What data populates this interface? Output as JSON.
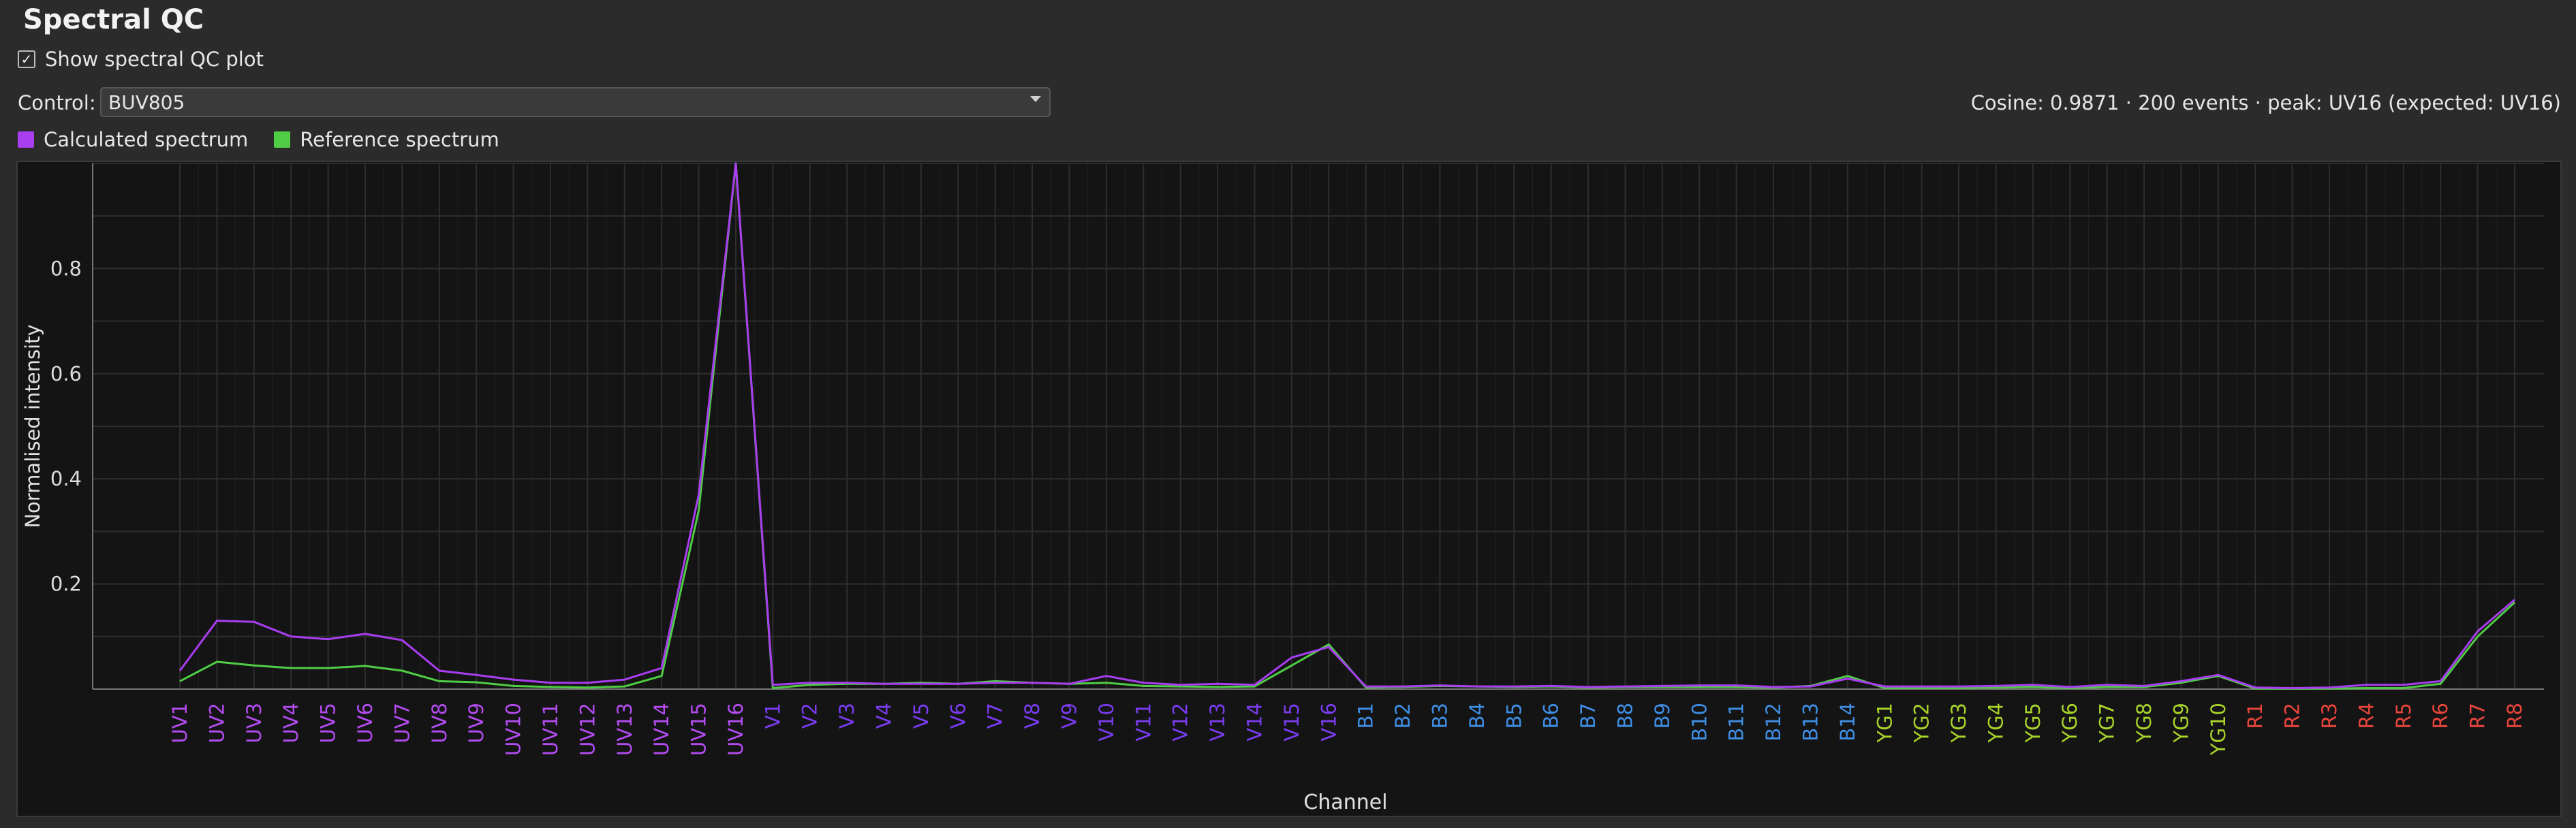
{
  "header": {
    "title": "Spectral QC"
  },
  "toggle": {
    "label": "Show spectral QC plot",
    "checked": true,
    "check_glyph": "✓"
  },
  "control": {
    "label": "Control:",
    "value": "BUV805"
  },
  "stats": "Cosine: 0.9871 · 200 events · peak: UV16 (expected: UV16)",
  "legend": [
    {
      "label": "Calculated spectrum",
      "color": "#a93df0"
    },
    {
      "label": "Reference spectrum",
      "color": "#4fce45"
    }
  ],
  "chart_data": {
    "type": "line",
    "xlabel": "Channel",
    "ylabel": "Normalised intensity",
    "ylim": [
      0,
      1
    ],
    "yticks": [
      0.2,
      0.4,
      0.6,
      0.8
    ],
    "grid": true,
    "legend_position": "top-left",
    "categories": [
      "UV1",
      "UV2",
      "UV3",
      "UV4",
      "UV5",
      "UV6",
      "UV7",
      "UV8",
      "UV9",
      "UV10",
      "UV11",
      "UV12",
      "UV13",
      "UV14",
      "UV15",
      "UV16",
      "V1",
      "V2",
      "V3",
      "V4",
      "V5",
      "V6",
      "V7",
      "V8",
      "V9",
      "V10",
      "V11",
      "V12",
      "V13",
      "V14",
      "V15",
      "V16",
      "B1",
      "B2",
      "B3",
      "B4",
      "B5",
      "B6",
      "B7",
      "B8",
      "B9",
      "B10",
      "B11",
      "B12",
      "B13",
      "B14",
      "YG1",
      "YG2",
      "YG3",
      "YG4",
      "YG5",
      "YG6",
      "YG7",
      "YG8",
      "YG9",
      "YG10",
      "R1",
      "R2",
      "R3",
      "R4",
      "R5",
      "R6",
      "R7",
      "R8"
    ],
    "category_colors": {
      "UV": "#b44cf2",
      "V": "#7a3cf0",
      "B": "#3f8fe6",
      "YG": "#a8d42a",
      "R": "#e8453c"
    },
    "series": [
      {
        "name": "Calculated spectrum",
        "color": "#a93df0",
        "values": [
          0.035,
          0.13,
          0.128,
          0.1,
          0.095,
          0.105,
          0.093,
          0.035,
          0.027,
          0.018,
          0.012,
          0.012,
          0.018,
          0.04,
          0.37,
          1.0,
          0.008,
          0.012,
          0.012,
          0.01,
          0.01,
          0.01,
          0.012,
          0.012,
          0.01,
          0.025,
          0.012,
          0.008,
          0.01,
          0.008,
          0.06,
          0.08,
          0.005,
          0.005,
          0.007,
          0.005,
          0.005,
          0.006,
          0.004,
          0.005,
          0.006,
          0.007,
          0.007,
          0.004,
          0.005,
          0.02,
          0.005,
          0.005,
          0.005,
          0.006,
          0.008,
          0.004,
          0.008,
          0.006,
          0.015,
          0.027,
          0.003,
          0.002,
          0.003,
          0.008,
          0.008,
          0.015,
          0.11,
          0.17
        ]
      },
      {
        "name": "Reference spectrum",
        "color": "#4fce45",
        "values": [
          0.015,
          0.052,
          0.045,
          0.04,
          0.04,
          0.044,
          0.035,
          0.015,
          0.013,
          0.006,
          0.004,
          0.003,
          0.005,
          0.025,
          0.34,
          1.0,
          0.002,
          0.008,
          0.01,
          0.01,
          0.012,
          0.01,
          0.015,
          0.012,
          0.01,
          0.012,
          0.006,
          0.005,
          0.004,
          0.005,
          0.045,
          0.085,
          0.003,
          0.004,
          0.006,
          0.005,
          0.004,
          0.005,
          0.003,
          0.004,
          0.004,
          0.004,
          0.004,
          0.003,
          0.006,
          0.025,
          0.002,
          0.002,
          0.002,
          0.003,
          0.004,
          0.002,
          0.004,
          0.004,
          0.012,
          0.025,
          0.001,
          0.001,
          0.001,
          0.002,
          0.002,
          0.01,
          0.1,
          0.165
        ]
      }
    ]
  }
}
